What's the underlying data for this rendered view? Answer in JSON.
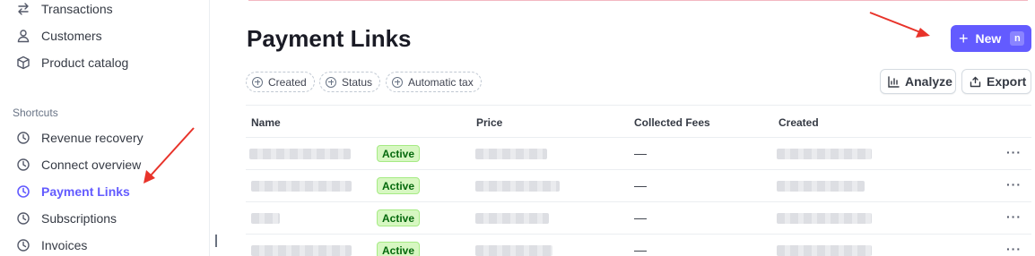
{
  "sidebar": {
    "items_top": [
      {
        "label": "Transactions",
        "icon": "arrows-exchange-icon"
      },
      {
        "label": "Customers",
        "icon": "person-icon"
      },
      {
        "label": "Product catalog",
        "icon": "box-icon"
      }
    ],
    "shortcuts_label": "Shortcuts",
    "shortcuts": [
      {
        "label": "Revenue recovery",
        "icon": "clock-icon"
      },
      {
        "label": "Connect overview",
        "icon": "clock-icon"
      },
      {
        "label": "Payment Links",
        "icon": "clock-icon",
        "active": true
      },
      {
        "label": "Subscriptions",
        "icon": "clock-icon"
      },
      {
        "label": "Invoices",
        "icon": "clock-icon"
      }
    ]
  },
  "main": {
    "title": "Payment Links",
    "new_button": {
      "label": "New",
      "shortcut": "n"
    },
    "filters": [
      "Created",
      "Status",
      "Automatic tax"
    ],
    "actions": {
      "analyze": "Analyze",
      "export": "Export"
    },
    "table": {
      "columns": [
        "Name",
        "Price",
        "Collected Fees",
        "Created"
      ],
      "rows": [
        {
          "status": "Active",
          "collected_fees": "—"
        },
        {
          "status": "Active",
          "collected_fees": "—"
        },
        {
          "status": "Active",
          "collected_fees": "—"
        },
        {
          "status": "Active",
          "collected_fees": "—"
        }
      ],
      "row_menu": "···"
    }
  },
  "colors": {
    "accent": "#635bff",
    "badge_bg": "#d7f7c2",
    "badge_text": "#05690d",
    "annotation_arrow": "#e8332a"
  }
}
